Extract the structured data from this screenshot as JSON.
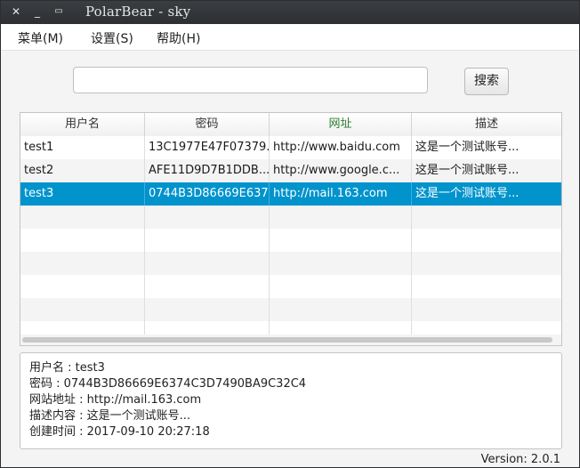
{
  "window": {
    "title": "PolarBear - sky",
    "controls": [
      "✕",
      "_",
      "▭"
    ]
  },
  "menubar": [
    {
      "label": "菜单(M)"
    },
    {
      "label": "设置(S)"
    },
    {
      "label": "帮助(H)"
    }
  ],
  "search": {
    "value": "",
    "placeholder": "",
    "button_label": "搜索"
  },
  "table": {
    "columns": [
      "用户名",
      "密码",
      "网址",
      "描述"
    ],
    "header_colors": [
      "#333333",
      "#333333",
      "#2e7d32",
      "#333333"
    ],
    "rows": [
      {
        "username": "test1",
        "password": "13C1977E47F07379...",
        "url": "http://www.baidu.com",
        "desc": "这是一个测试账号..."
      },
      {
        "username": "test2",
        "password": "AFE11D9D7B1DDB...",
        "url": "http://www.google.c...",
        "desc": "这是一个测试账号..."
      },
      {
        "username": "test3",
        "password": "0744B3D86669E637...",
        "url": "http://mail.163.com",
        "desc": "这是一个测试账号..."
      }
    ],
    "selected_row": 2,
    "empty_rows": 6
  },
  "detail": {
    "lines": [
      "用户名 : test3",
      "密码 : 0744B3D86669E6374C3D7490BA9C32C4",
      "网站地址 : http://mail.163.com",
      "描述内容 : 这是一个测试账号...",
      "创建时间 : 2017-09-10 20:27:18"
    ]
  },
  "version": "Version: 2.0.1",
  "colors": {
    "selection": "#0093cc",
    "titlebar": "#2d2f32"
  }
}
